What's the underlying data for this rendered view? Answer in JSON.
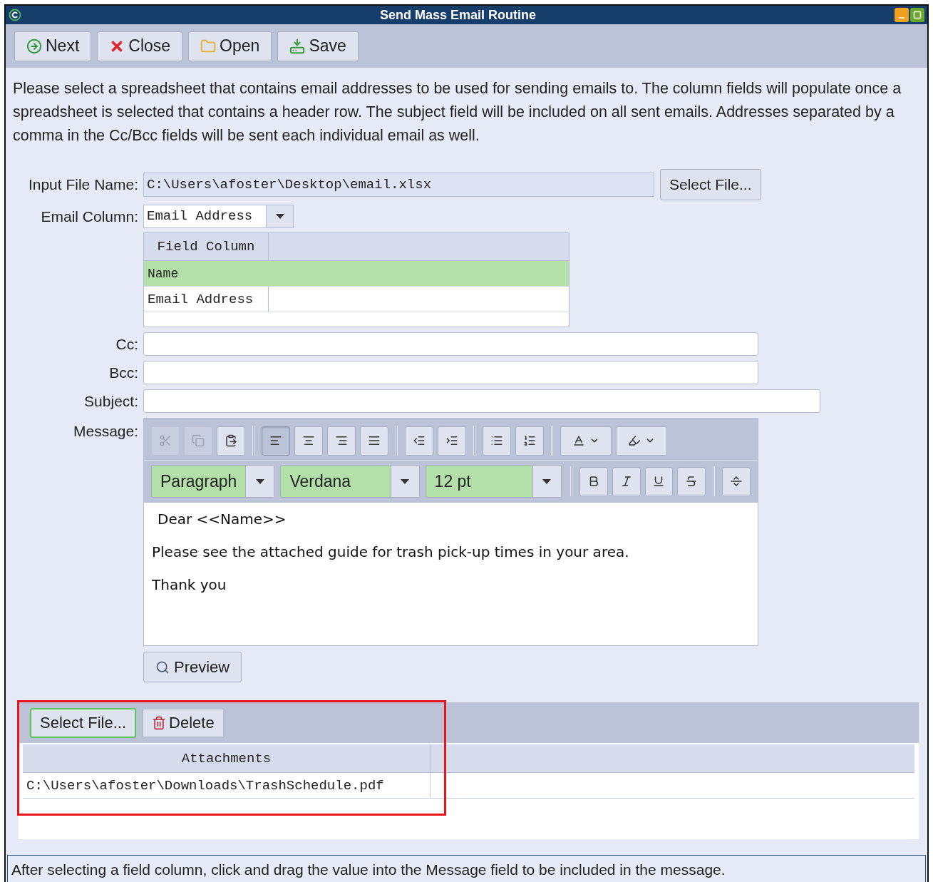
{
  "window": {
    "title": "Send Mass Email Routine"
  },
  "toolbar": [
    {
      "kind": "next",
      "label": "Next"
    },
    {
      "kind": "close",
      "label": "Close"
    },
    {
      "kind": "open",
      "label": "Open"
    },
    {
      "kind": "save",
      "label": "Save"
    }
  ],
  "instructions": "Please select a spreadsheet that contains email addresses to be used for sending emails to. The column fields will populate once a spreadsheet is selected that contains a header row. The subject field will be included on all sent emails. Addresses separated by a comma in the Cc/Bcc fields will be sent each individual email as well.",
  "input_file": {
    "label": "Input File Name:",
    "value": "C:\\Users\\afoster\\Desktop\\email.xlsx",
    "button": "Select File..."
  },
  "email_column": {
    "label": "Email Column:",
    "value": "Email Address"
  },
  "field_table": {
    "columns": [
      "Field Column"
    ],
    "rows": [
      {
        "cells": [
          "Name"
        ],
        "selected": true
      },
      {
        "cells": [
          "Email Address"
        ],
        "selected": false
      }
    ]
  },
  "cc": {
    "label": "Cc:"
  },
  "bcc": {
    "label": "Bcc:"
  },
  "subject": {
    "label": "Subject:"
  },
  "message": {
    "label": "Message:",
    "tool_groups": [
      [
        {
          "kind": "cut",
          "disabled": true,
          "selected": false
        },
        {
          "kind": "copy",
          "disabled": true,
          "selected": false
        },
        {
          "kind": "paste",
          "disabled": false,
          "selected": false
        }
      ],
      [
        {
          "kind": "align-left",
          "disabled": false,
          "selected": true
        },
        {
          "kind": "align-center",
          "disabled": false,
          "selected": false
        },
        {
          "kind": "align-right",
          "disabled": false,
          "selected": false
        },
        {
          "kind": "justify",
          "disabled": false,
          "selected": false
        }
      ],
      [
        {
          "kind": "outdent",
          "disabled": false,
          "selected": false
        },
        {
          "kind": "indent",
          "disabled": false,
          "selected": false
        }
      ],
      [
        {
          "kind": "bullets",
          "disabled": false,
          "selected": false
        },
        {
          "kind": "numbering",
          "disabled": false,
          "selected": false
        }
      ],
      [
        {
          "kind": "font-color",
          "disabled": false,
          "selected": false
        },
        {
          "kind": "highlight",
          "disabled": false,
          "selected": false
        }
      ]
    ],
    "selects": [
      {
        "kind": "block",
        "value": "Paragraph"
      },
      {
        "kind": "font",
        "value": "Verdana"
      },
      {
        "kind": "size",
        "value": "12 pt"
      }
    ],
    "format_groups": [
      [
        {
          "kind": "bold",
          "disabled": false,
          "selected": false
        },
        {
          "kind": "italic",
          "disabled": false,
          "selected": false
        },
        {
          "kind": "underline",
          "disabled": false,
          "selected": false
        },
        {
          "kind": "strike",
          "disabled": false,
          "selected": false
        }
      ],
      [
        {
          "kind": "rule",
          "disabled": false,
          "selected": false
        }
      ]
    ],
    "body": [
      "Dear <<Name>>",
      "Please see the attached guide for trash pick-up times in your area.",
      "Thank you"
    ],
    "preview_button": "Preview"
  },
  "attachments": {
    "buttons": [
      {
        "kind": "select",
        "label": "Select File...",
        "focused": true
      },
      {
        "kind": "delete",
        "label": "Delete",
        "focused": false
      }
    ],
    "columns": [
      "Attachments"
    ],
    "rows": [
      [
        "C:\\Users\\afoster\\Downloads\\TrashSchedule.pdf"
      ]
    ],
    "highlighted": true
  },
  "status_bar": "After selecting a field column, click and drag the value into the Message field to be included in the message."
}
